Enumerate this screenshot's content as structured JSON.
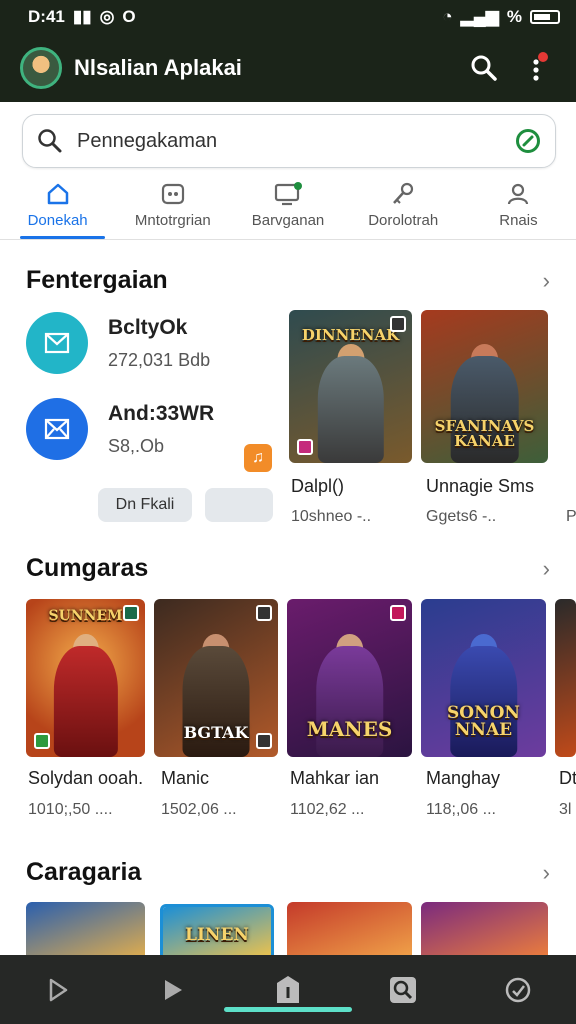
{
  "status": {
    "time": "D:41",
    "extra": "O",
    "battery_text": "%"
  },
  "app": {
    "title": "Nlsalian Aplakai"
  },
  "search": {
    "placeholder": "Pennegakaman"
  },
  "tabs": [
    {
      "label": "Donekah",
      "icon": "home-icon",
      "active": true
    },
    {
      "label": "Mntotrgrian",
      "icon": "game-controller-icon",
      "active": false
    },
    {
      "label": "Barvganan",
      "icon": "monitor-icon",
      "active": false
    },
    {
      "label": "Dorolotrah",
      "icon": "key-icon",
      "active": false
    },
    {
      "label": "Rnais",
      "icon": "person-icon",
      "active": false
    }
  ],
  "featured": {
    "title": "Fentergaian",
    "apps": [
      {
        "name": "BcltyOk",
        "sub": "272,031 Bdb",
        "color": "#22b5c8"
      },
      {
        "name": "And:33WR",
        "sub": "S8,.Ob",
        "color": "#1f6fe5"
      }
    ],
    "button_label": "Dn Fkali",
    "games": [
      {
        "name": "Dalpl()",
        "sub": "10shneo -..",
        "banner": "DINNENAK",
        "colors": [
          "#2f4b4f",
          "#7a5a2c"
        ]
      },
      {
        "name": "Unnagie Sms",
        "sub": "Ggets6 -..",
        "banner": "SFANINAVS KANAE",
        "colors": [
          "#a63a1e",
          "#3d5f3a"
        ]
      }
    ],
    "clipped": "P"
  },
  "section2": {
    "title": "Cumgaras",
    "games": [
      {
        "name": "Solydan ooah.",
        "sub": "1010;,50 ....",
        "banner": "SUNNEM",
        "colors": [
          "#b7441a",
          "#f2a94a"
        ]
      },
      {
        "name": "Manic",
        "sub": "1502,06 ...",
        "banner": "BGTAK",
        "colors": [
          "#3c2a20",
          "#b25a2a"
        ]
      },
      {
        "name": "Mahkar ian",
        "sub": "1102,62 ...",
        "banner": "MANES",
        "colors": [
          "#6a1c6c",
          "#2b1440"
        ]
      },
      {
        "name": "Manghay",
        "sub": "118;,06 ...",
        "banner": "SONON NNAE",
        "colors": [
          "#2a3d8f",
          "#6d3c9e"
        ]
      }
    ],
    "clipped_name": "Dt",
    "clipped_sub": "3l"
  },
  "section3": {
    "title": "Caragaria",
    "games": [
      {
        "banner": "",
        "colors": [
          "#2a5fae",
          "#e7b04a"
        ]
      },
      {
        "banner": "LINEN",
        "colors": [
          "#1c8fd6",
          "#f1c34a"
        ]
      },
      {
        "banner": "",
        "colors": [
          "#c43a2a",
          "#f2a64a"
        ]
      },
      {
        "banner": "",
        "colors": [
          "#7a2a7e",
          "#f0813a"
        ]
      }
    ]
  },
  "bottom_nav": [
    {
      "icon": "play-outline-icon"
    },
    {
      "icon": "play-icon"
    },
    {
      "icon": "info-icon"
    },
    {
      "icon": "search-icon"
    },
    {
      "icon": "refresh-icon"
    }
  ]
}
